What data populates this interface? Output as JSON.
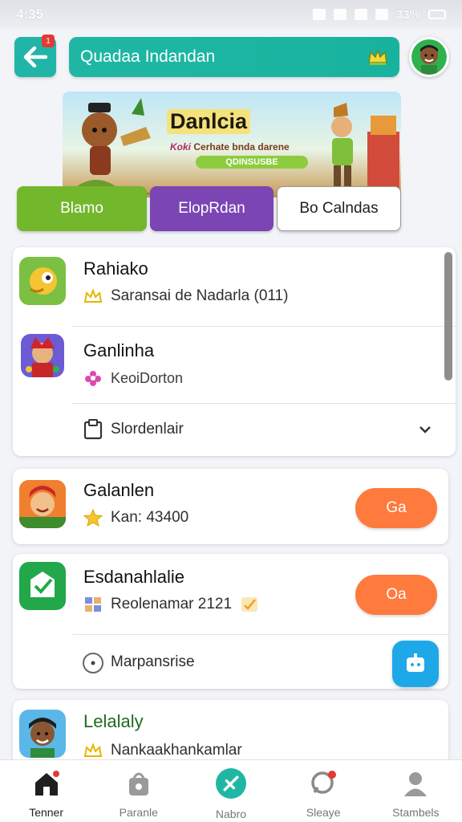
{
  "status": {
    "time": "4:35",
    "battery": "33%"
  },
  "header": {
    "back_badge": "1",
    "search_label": "Quadaa Indandan",
    "search_icon": "crown-icon",
    "avatar_icon": "avatar-icon"
  },
  "banner": {
    "title": "Danlcia",
    "subtitle_highlight": "Koki",
    "subtitle_rest": "Cerhate bnda darene",
    "cta": "QDINSUSBE"
  },
  "categories": [
    "Blamo",
    "ElopRdan",
    "Bo Calndas"
  ],
  "card1": {
    "items": [
      {
        "title": "Rahiako",
        "sub": "Saransai de Nadarla (011)",
        "icon": "joystick-app-icon",
        "sub_icon": "crown-icon"
      },
      {
        "title": "Ganlinha",
        "sub": "KeoiDorton",
        "icon": "character-app-icon",
        "sub_icon": "flower-icon"
      }
    ],
    "footer": {
      "label": "Slordenlair",
      "icon": "clipboard-icon"
    }
  },
  "card2": {
    "title": "Galanlen",
    "sub": "Kan: 43400",
    "button": "Ga"
  },
  "card3": {
    "title": "Esdanahlalie",
    "sub": "Reolenamar 2121",
    "button": "Oa",
    "footer_label": "Marpansrise"
  },
  "card4": {
    "title": "Lelalaly",
    "sub": "Nankaakhankamlar"
  },
  "nav": [
    {
      "label": "Tenner",
      "icon": "home-icon",
      "active": true
    },
    {
      "label": "Paranle",
      "icon": "bag-icon"
    },
    {
      "label": "Nabro",
      "icon": "compass-icon"
    },
    {
      "label": "Sleaye",
      "icon": "chat-icon"
    },
    {
      "label": "Stambels",
      "icon": "profile-icon"
    }
  ],
  "colors": {
    "teal": "#21b5a7",
    "green": "#73b72d",
    "purple": "#7b45b4",
    "orange": "#ff7a3d",
    "blue": "#1ea8e8"
  }
}
